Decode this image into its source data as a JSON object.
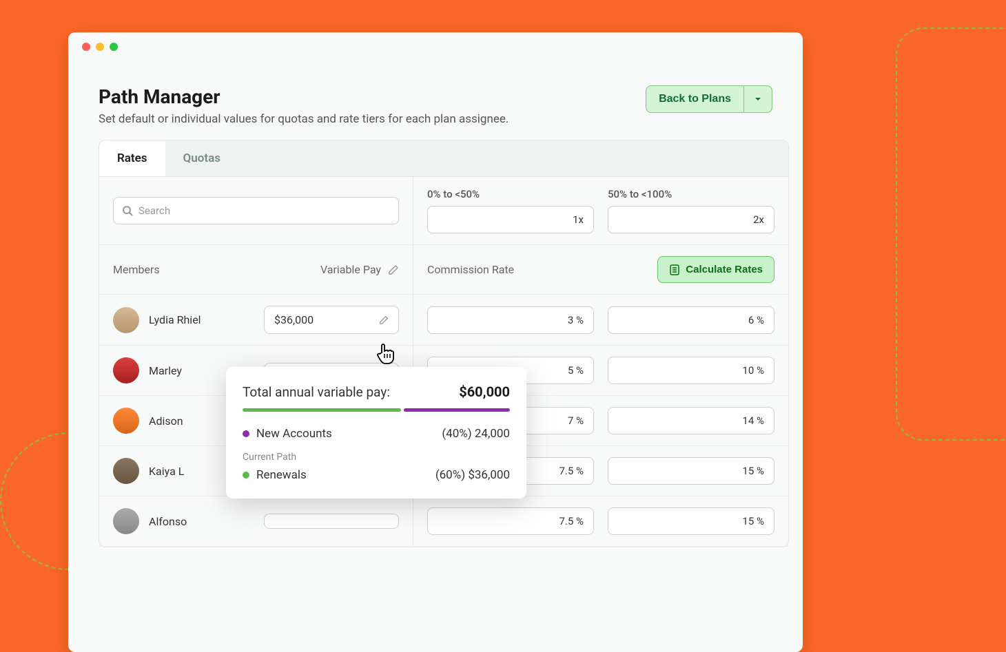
{
  "header": {
    "title": "Path Manager",
    "subtitle": "Set default or individual values for quotas and rate tiers for each plan assignee.",
    "back_label": "Back to Plans"
  },
  "tabs": {
    "rates": "Rates",
    "quotas": "Quotas"
  },
  "search": {
    "placeholder": "Search"
  },
  "tiers": [
    {
      "label": "0% to <50%",
      "value": "1x"
    },
    {
      "label": "50% to <100%",
      "value": "2x"
    }
  ],
  "columns": {
    "members": "Members",
    "variable_pay": "Variable Pay",
    "commission_rate": "Commission Rate",
    "calculate": "Calculate Rates"
  },
  "rows": [
    {
      "name": "Lydia Rhiel",
      "varpay": "$36,000",
      "rate1": "3 %",
      "rate2": "6 %"
    },
    {
      "name": "Marley",
      "varpay": "",
      "rate1": "5 %",
      "rate2": "10 %"
    },
    {
      "name": "Adison",
      "varpay": "",
      "rate1": "7 %",
      "rate2": "14 %"
    },
    {
      "name": "Kaiya L",
      "varpay": "",
      "rate1": "7.5 %",
      "rate2": "15 %"
    },
    {
      "name": "Alfonso",
      "varpay": "",
      "rate1": "7.5 %",
      "rate2": "15 %"
    }
  ],
  "tooltip": {
    "title": "Total annual variable pay:",
    "total": "$60,000",
    "line1_label": "New Accounts",
    "line1_value": "(40%) 24,000",
    "sub": "Current Path",
    "line2_label": "Renewals",
    "line2_value": "(60%) $36,000"
  }
}
